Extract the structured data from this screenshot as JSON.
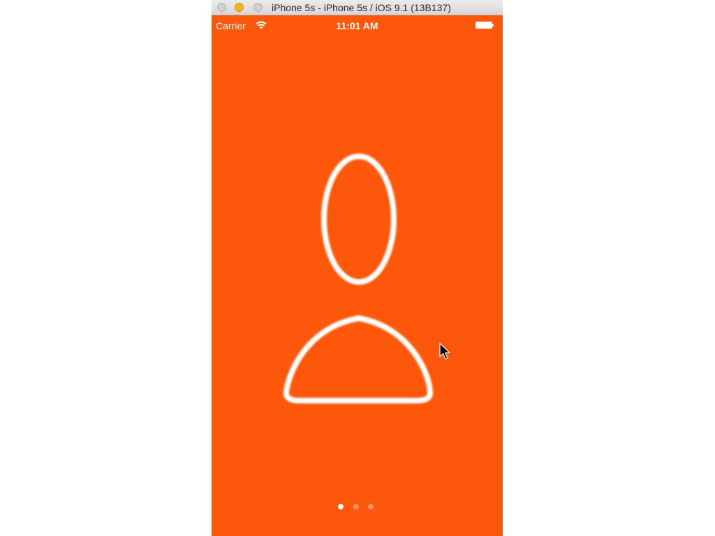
{
  "window": {
    "title": "iPhone 5s - iPhone 5s / iOS 9.1 (13B137)"
  },
  "statusbar": {
    "carrier": "Carrier",
    "time": "11:01 AM",
    "wifi_icon": "wifi-icon",
    "battery_icon": "battery-full-icon",
    "battery_level": 1.0
  },
  "screen": {
    "background_color": "#fc570a",
    "illustration_icon": "user-outline-icon"
  },
  "pager": {
    "page_count": 3,
    "current_page": 1
  },
  "colors": {
    "accent": "#fc570a",
    "foreground": "#ffffff",
    "titlebar": "#e0e0e0",
    "minimize_button": "#f5b121"
  }
}
